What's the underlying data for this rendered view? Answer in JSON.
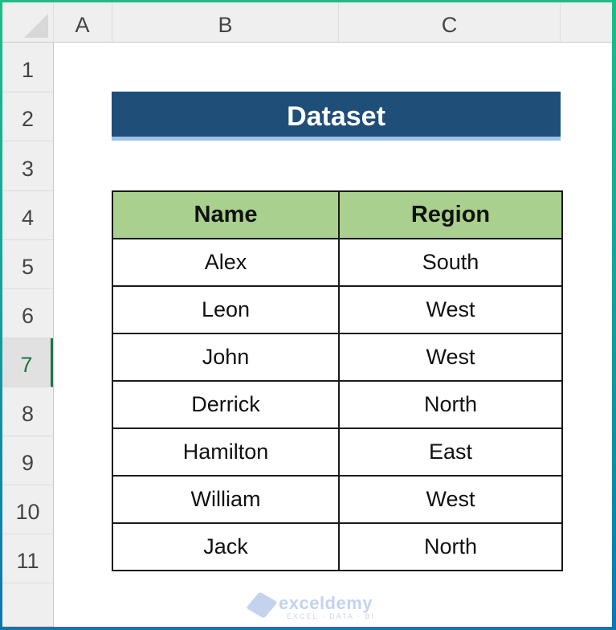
{
  "sheet": {
    "columns": [
      "A",
      "B",
      "C",
      ""
    ],
    "rows": [
      "1",
      "2",
      "3",
      "4",
      "5",
      "6",
      "7",
      "8",
      "9",
      "10",
      "11",
      ""
    ],
    "selected_row": "7"
  },
  "title": "Dataset",
  "table": {
    "headers": [
      "Name",
      "Region"
    ],
    "rows": [
      [
        "Alex",
        "South"
      ],
      [
        "Leon",
        "West"
      ],
      [
        "John",
        "West"
      ],
      [
        "Derrick",
        "North"
      ],
      [
        "Hamilton",
        "East"
      ],
      [
        "William",
        "West"
      ],
      [
        "Jack",
        "North"
      ]
    ]
  },
  "watermark": {
    "name": "exceldemy",
    "tagline": "EXCEL · DATA · BI"
  },
  "colors": {
    "title_bg": "#1f4e79",
    "header_bg": "#a9d08e",
    "accent": "#217346"
  }
}
